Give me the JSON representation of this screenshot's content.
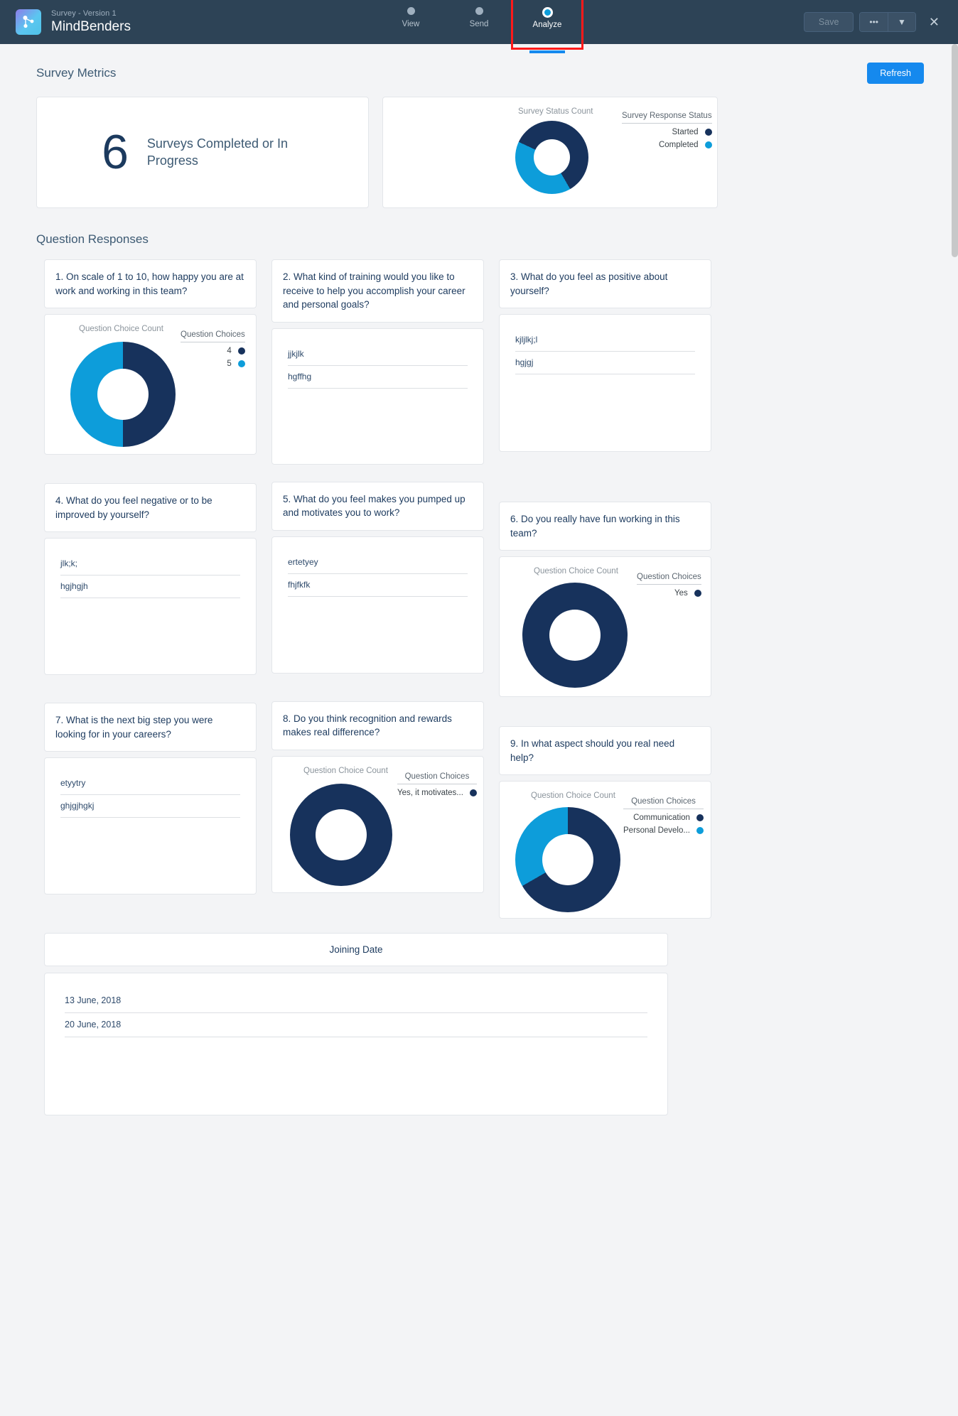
{
  "header": {
    "app_subtitle": "Survey - Version 1",
    "app_title": "MindBenders",
    "app_icon": "survey-network-icon",
    "steps": [
      {
        "label": "View",
        "active": false
      },
      {
        "label": "Send",
        "active": false
      },
      {
        "label": "Analyze",
        "active": true
      }
    ],
    "save_label": "Save",
    "more_label": "•••",
    "dropdown_label": "▼",
    "close_label": "✕"
  },
  "metrics": {
    "section_title": "Survey Metrics",
    "refresh_label": "Refresh",
    "completed_count": "6",
    "completed_label": "Surveys Completed or In Progress"
  },
  "status_chart": {
    "caption": "Survey Status Count",
    "legend_title": "Survey Response Status",
    "legend": [
      {
        "label": "Started",
        "color": "#17325c"
      },
      {
        "label": "Completed",
        "color": "#0d9dda"
      }
    ]
  },
  "questions_section_title": "Question Responses",
  "colors": {
    "navy": "#17325c",
    "blue": "#0d9dda",
    "accent": "#1589ee",
    "header_bg": "#2d4356",
    "page_bg": "#f3f4f6"
  },
  "questions": [
    {
      "title": "1. On scale of 1 to 10, how happy you are at work and working in this team?",
      "type": "donut",
      "chart_caption": "Question Choice Count",
      "legend_title": "Question Choices",
      "legend": [
        {
          "label": "4",
          "color": "#17325c"
        },
        {
          "label": "5",
          "color": "#0d9dda"
        }
      ]
    },
    {
      "title": "2. What kind of training would you like to receive to help you accomplish your career and personal goals?",
      "type": "text",
      "answers": [
        "jjkjlk",
        "hgffhg"
      ]
    },
    {
      "title": "3. What do you feel as positive about yourself?",
      "type": "text",
      "answers": [
        "kjljlkj;l",
        "hgjgj"
      ]
    },
    {
      "title": "4. What do you feel negative or to be improved by yourself?",
      "type": "text",
      "answers": [
        "jlk;k;",
        "hgjhgjh"
      ]
    },
    {
      "title": "5. What do you feel makes you pumped up and motivates you to work?",
      "type": "text",
      "answers": [
        "ertetyey",
        "fhjfkfk"
      ]
    },
    {
      "title": "6. Do you really have fun working in this team?",
      "type": "donut",
      "chart_caption": "Question Choice Count",
      "legend_title": "Question Choices",
      "legend": [
        {
          "label": "Yes",
          "color": "#17325c"
        }
      ]
    },
    {
      "title": "7. What is the next big step you were looking for in your careers?",
      "type": "text",
      "answers": [
        "etyytry",
        "ghjgjhgkj"
      ]
    },
    {
      "title": "8. Do you think recognition and rewards makes real difference?",
      "type": "donut",
      "chart_caption": "Question Choice Count",
      "legend_title": "Question Choices",
      "legend": [
        {
          "label": "Yes, it motivates...",
          "color": "#17325c"
        }
      ]
    },
    {
      "title": "9. In what aspect should you real need help?",
      "type": "donut",
      "chart_caption": "Question Choice Count",
      "legend_title": "Question Choices",
      "legend": [
        {
          "label": "Communication",
          "color": "#17325c"
        },
        {
          "label": "Personal Develo...",
          "color": "#0d9dda"
        }
      ]
    }
  ],
  "joining_date": {
    "title": "Joining Date",
    "answers": [
      "13 June, 2018",
      "20 June, 2018"
    ]
  },
  "chart_data": [
    {
      "type": "pie",
      "title": "Survey Status Count",
      "legend_title": "Survey Response Status",
      "legend_position": "right",
      "categories": [
        "Started",
        "Completed"
      ],
      "values": [
        60,
        40
      ],
      "colors": [
        "#17325c",
        "#0d9dda"
      ]
    },
    {
      "type": "pie",
      "title": "Question Choice Count",
      "legend_title": "Question Choices",
      "legend_position": "right",
      "categories": [
        "4",
        "5"
      ],
      "values": [
        50,
        50
      ],
      "colors": [
        "#17325c",
        "#0d9dda"
      ]
    },
    {
      "type": "pie",
      "title": "Question Choice Count",
      "legend_title": "Question Choices",
      "legend_position": "right",
      "categories": [
        "Yes"
      ],
      "values": [
        100
      ],
      "colors": [
        "#17325c"
      ]
    },
    {
      "type": "pie",
      "title": "Question Choice Count",
      "legend_title": "Question Choices",
      "legend_position": "right",
      "categories": [
        "Yes, it motivates..."
      ],
      "values": [
        100
      ],
      "colors": [
        "#17325c"
      ]
    },
    {
      "type": "pie",
      "title": "Question Choice Count",
      "legend_title": "Question Choices",
      "legend_position": "right",
      "categories": [
        "Communication",
        "Personal Develo..."
      ],
      "values": [
        70,
        30
      ],
      "colors": [
        "#17325c",
        "#0d9dda"
      ]
    }
  ]
}
